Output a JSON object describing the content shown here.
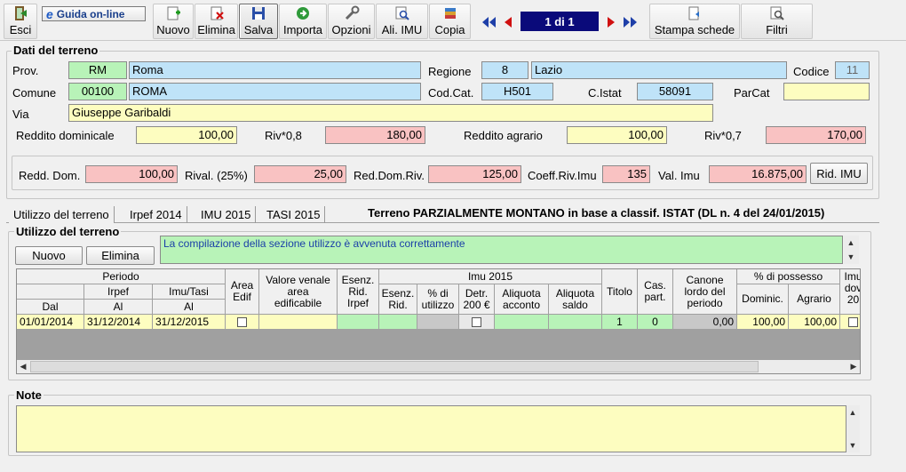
{
  "toolbar": {
    "exit": "Esci",
    "guide_e": "e",
    "guide": "Guida on-line",
    "new": "Nuovo",
    "delete": "Elimina",
    "save": "Salva",
    "import": "Importa",
    "options": "Opzioni",
    "imu_rates": "Ali. IMU",
    "copy": "Copia",
    "record_counter": "1 di 1",
    "print_sheets": "Stampa schede",
    "filters": "Filtri"
  },
  "land": {
    "title": "Dati del terreno",
    "prov_label": "Prov.",
    "prov_code": "RM",
    "prov_name": "Roma",
    "region_label": "Regione",
    "region_code": "8",
    "region_name": "Lazio",
    "code_label": "Codice",
    "code_value": "11",
    "comune_label": "Comune",
    "cap": "00100",
    "comune_name": "ROMA",
    "codcat_label": "Cod.Cat.",
    "codcat": "H501",
    "istat_label": "C.Istat",
    "istat": "58091",
    "parcat_label": "ParCat",
    "parcat": "",
    "via_label": "Via",
    "via": "Giuseppe Garibaldi",
    "redd_dom_label": "Reddito dominicale",
    "redd_dom": "100,00",
    "riv08_label": "Riv*0,8",
    "riv08": "180,00",
    "redd_agr_label": "Reddito agrario",
    "redd_agr": "100,00",
    "riv07_label": "Riv*0,7",
    "riv07": "170,00",
    "rd_label": "Redd. Dom.",
    "rd": "100,00",
    "rival_label": "Rival. (25%)",
    "rival": "25,00",
    "rdr_label": "Red.Dom.Riv.",
    "rdr": "125,00",
    "coeff_label": "Coeff.Riv.Imu",
    "coeff": "135",
    "valimu_label": "Val. Imu",
    "valimu": "16.875,00",
    "rid_imu_button": "Rid. IMU"
  },
  "tabs": [
    "Utilizzo del terreno",
    "Irpef 2014",
    "IMU 2015",
    "TASI 2015"
  ],
  "classification_note": "Terreno PARZIALMENTE MONTANO in base a classif. ISTAT (DL n. 4 del 24/01/2015)",
  "usage": {
    "title": "Utilizzo del terreno",
    "new_button": "Nuovo",
    "delete_button": "Elimina",
    "message": "La compilazione della sezione utilizzo è avvenuta correttamente"
  },
  "grid": {
    "h_periodo": "Periodo",
    "h_irpef": "Irpef",
    "h_imutasi": "Imu/Tasi",
    "h_dal": "Dal",
    "h_al1": "Al",
    "h_al2": "Al",
    "h_area_edif": "Area Edif",
    "h_valore": "Valore venale area edificabile",
    "h_esenz_irpef": "Esenz. Rid. Irpef",
    "h_imu2015": "Imu 2015",
    "h_esenz_rid": "Esenz. Rid.",
    "h_pct_util": "% di utilizzo",
    "h_detr": "Detr. 200 €",
    "h_aliq_acc": "Aliquota acconto",
    "h_aliq_saldo": "Aliquota saldo",
    "h_titolo": "Titolo",
    "h_cas": "Cas. part.",
    "h_canone": "Canone lordo del periodo",
    "h_possesso": "% di possesso",
    "h_domin": "Dominic.",
    "h_agrario": "Agrario",
    "h_imu_dov_1": "Imu",
    "h_imu_dov_2": "dov",
    "h_imu_dov_3": "20",
    "row": {
      "dal": "01/01/2014",
      "al_irpef": "31/12/2014",
      "al_imu": "31/12/2015",
      "titolo": "1",
      "cas": "0",
      "canone": "0,00",
      "domin": "100,00",
      "agrario": "100,00"
    }
  },
  "notes": {
    "title": "Note",
    "text": ""
  }
}
